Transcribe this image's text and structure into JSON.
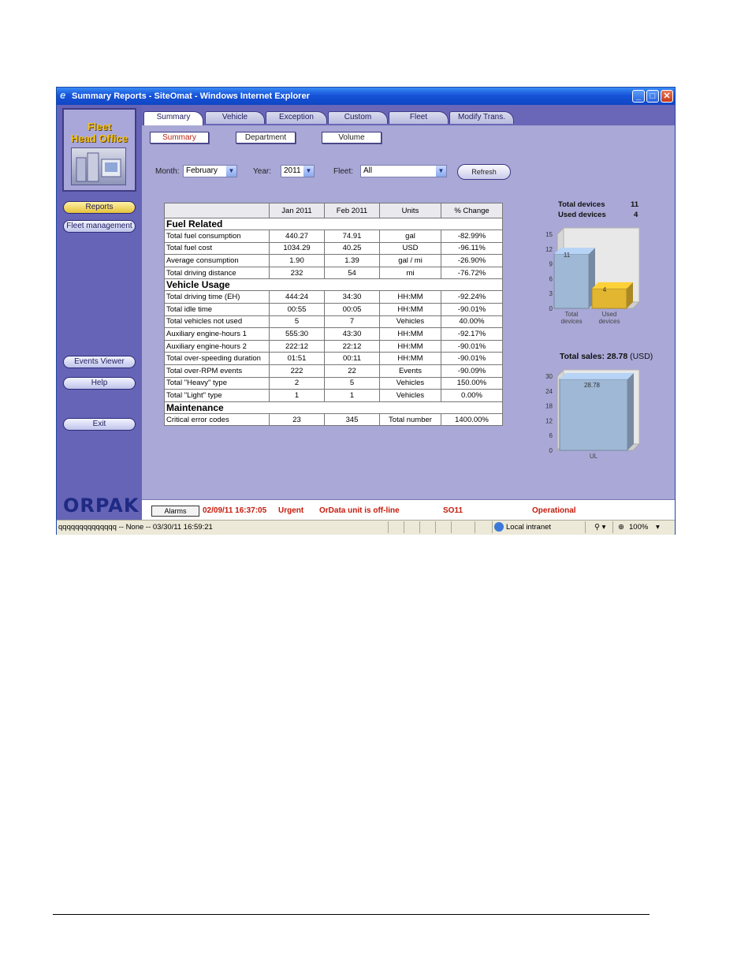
{
  "window": {
    "title": "Summary Reports - SiteOmat - Windows Internet Explorer",
    "min": "_",
    "max": "□",
    "close": "✕"
  },
  "left": {
    "logo": {
      "line1": "Fleet",
      "line2": "Head Office"
    },
    "nav": {
      "reports": "Reports",
      "fleet_mgmt": "Fleet management",
      "events": "Events Viewer",
      "help": "Help",
      "exit": "Exit"
    },
    "brand": "ORPAK"
  },
  "tabs": [
    "Summary",
    "Vehicle",
    "Exception",
    "Custom",
    "Fleet",
    "Modify Trans."
  ],
  "subtabs": [
    "Summary",
    "Department",
    "Volume"
  ],
  "filters": {
    "month_label": "Month:",
    "month_value": "February",
    "year_label": "Year:",
    "year_value": "2011",
    "fleet_label": "Fleet:",
    "fleet_value": "All",
    "refresh": "Refresh"
  },
  "report": {
    "headers": [
      "",
      "Jan 2011",
      "Feb 2011",
      "Units",
      "% Change"
    ],
    "sections": [
      {
        "title": "Fuel Related",
        "rows": [
          [
            "Total fuel consumption",
            "440.27",
            "74.91",
            "gal",
            "-82.99%"
          ],
          [
            "Total fuel cost",
            "1034.29",
            "40.25",
            "USD",
            "-96.11%"
          ],
          [
            "Average consumption",
            "1.90",
            "1.39",
            "gal / mi",
            "-26.90%"
          ],
          [
            "Total driving distance",
            "232",
            "54",
            "mi",
            "-76.72%"
          ]
        ]
      },
      {
        "title": "Vehicle Usage",
        "rows": [
          [
            "Total driving time (EH)",
            "444:24",
            "34:30",
            "HH:MM",
            "-92.24%"
          ],
          [
            "Total idle time",
            "00:55",
            "00:05",
            "HH:MM",
            "-90.01%"
          ],
          [
            "Total vehicles not used",
            "5",
            "7",
            "Vehicles",
            "40.00%"
          ],
          [
            "Auxiliary engine-hours 1",
            "555:30",
            "43:30",
            "HH:MM",
            "-92.17%"
          ],
          [
            "Auxiliary engine-hours 2",
            "222:12",
            "22:12",
            "HH:MM",
            "-90.01%"
          ],
          [
            "Total over-speeding duration",
            "01:51",
            "00:11",
            "HH:MM",
            "-90.01%"
          ],
          [
            "Total over-RPM events",
            "222",
            "22",
            "Events",
            "-90.09%"
          ],
          [
            "Total \"Heavy\" type",
            "2",
            "5",
            "Vehicles",
            "150.00%"
          ],
          [
            "Total \"Light\" type",
            "1",
            "1",
            "Vehicles",
            "0.00%"
          ]
        ]
      },
      {
        "title": "Maintenance",
        "rows": [
          [
            "Critical error codes",
            "23",
            "345",
            "Total number",
            "1400.00%"
          ]
        ]
      }
    ]
  },
  "devices": {
    "total_label": "Total devices",
    "total_value": "11",
    "used_label": "Used devices",
    "used_value": "4"
  },
  "chart_data": [
    {
      "type": "bar",
      "categories": [
        "Total devices",
        "Used devices"
      ],
      "values": [
        11,
        4
      ],
      "ylim": [
        0,
        15
      ],
      "yticks": [
        "0",
        "3",
        "6",
        "9",
        "12",
        "15"
      ],
      "data_labels": [
        "11",
        "4"
      ],
      "colors": [
        "#9fb8d6",
        "#e2b631"
      ]
    },
    {
      "type": "bar",
      "title": "Total sales: 28.78 (USD)",
      "categories": [
        "UL"
      ],
      "values": [
        28.78
      ],
      "ylim": [
        0,
        30
      ],
      "yticks": [
        "0",
        "6",
        "12",
        "18",
        "24",
        "30"
      ],
      "data_labels": [
        "28.78"
      ],
      "colors": [
        "#9fb8d6"
      ]
    }
  ],
  "sales_title_bold": "Total sales: 28.78",
  "sales_title_unit": " (USD)",
  "status": {
    "alarms": "Alarms",
    "time": "02/09/11 16:37:05",
    "severity": "Urgent",
    "message": "OrData unit is off-line",
    "site": "SO11",
    "state": "Operational"
  },
  "ie_status": {
    "left": "qqqqqqqqqqqqqq -- None -- 03/30/11 16:59:21",
    "zone": "Local intranet",
    "zoom": "100%"
  }
}
